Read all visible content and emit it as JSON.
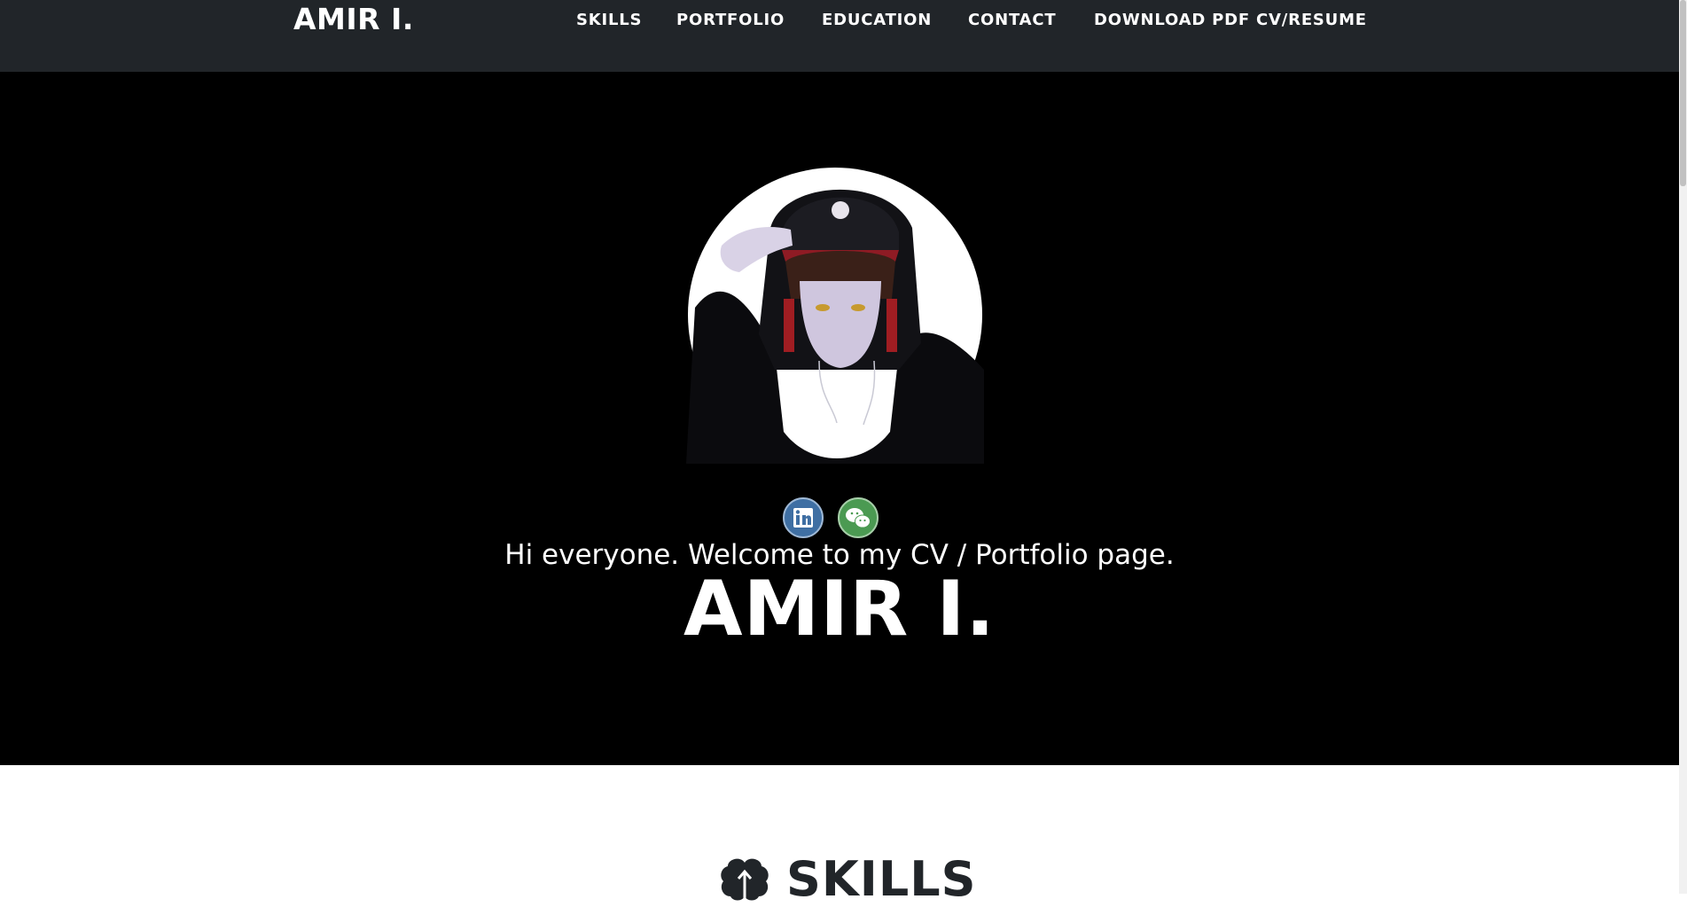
{
  "nav": {
    "brand": "AMIR I.",
    "links": [
      {
        "label": "SKILLS"
      },
      {
        "label": "PORTFOLIO"
      },
      {
        "label": "EDUCATION"
      },
      {
        "label": "CONTACT"
      },
      {
        "label": "DOWNLOAD PDF CV/RESUME"
      }
    ]
  },
  "hero": {
    "tagline": "Hi everyone. Welcome to my CV / Portfolio page.",
    "name": "AMIR I.",
    "social": [
      {
        "icon": "linkedin-icon"
      },
      {
        "icon": "wechat-icon"
      }
    ]
  },
  "skills": {
    "heading": "SKILLS",
    "icon": "brain-icon"
  },
  "colors": {
    "nav_bg": "#212529",
    "hero_bg": "#000000",
    "text_light": "#ffffff",
    "text_dark": "#212529"
  }
}
